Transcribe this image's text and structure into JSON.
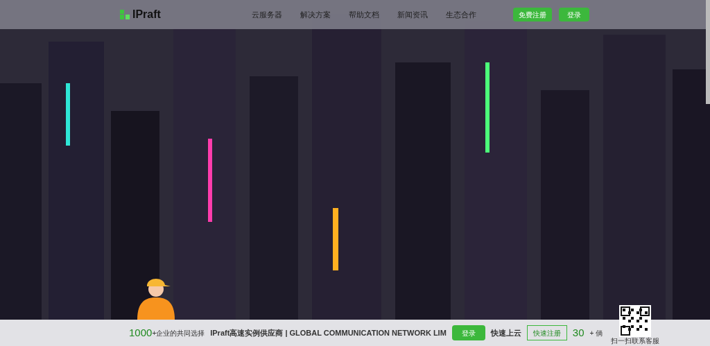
{
  "header": {
    "logo": "IPraft",
    "nav": [
      {
        "label": "云服务器"
      },
      {
        "label": "解决方案"
      },
      {
        "label": "帮助文档"
      },
      {
        "label": "新闻资讯"
      },
      {
        "label": "生态合作"
      }
    ],
    "register_button": "免费注册",
    "login_button": "登录"
  },
  "bottom_bar": {
    "count": "1000",
    "count_label": "+企业的共同选择",
    "title": "IPraft高速实例供应商 | GLOBAL COMMUNICATION NETWORK LIM",
    "login_button": "登录",
    "tagline": "快速上云",
    "register_button": "快速注册",
    "stat": "30",
    "stat_label": "+ 倘",
    "qr_caption": "扫一扫联系客服"
  }
}
